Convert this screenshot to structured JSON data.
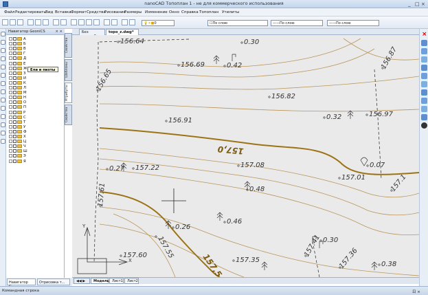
{
  "window": {
    "title": "nanoCAD Топоплан 1 - не для коммерческого использования",
    "controls": [
      "_",
      "□",
      "×"
    ]
  },
  "menu": [
    "Файл",
    "Редактировать",
    "Вид",
    "Вставка",
    "Формат",
    "Средства",
    "Рисование",
    "Размеры",
    "Изменение",
    "Окно",
    "Справка",
    "Топоплан",
    "Утилиты"
  ],
  "toolbar": {
    "layer": "0",
    "color": "По слою",
    "linetype": "По слою",
    "lineweight": "По слою"
  },
  "navigator": {
    "title": "Навигатор GeoniCS",
    "close": "× ×",
    "items": [
      "А",
      "Б",
      "В",
      "Г",
      "Д",
      "Е",
      "Ж",
      "З",
      "И",
      "К",
      "Л",
      "М",
      "Н",
      "О",
      "П",
      "Р",
      "С",
      "Т",
      "У",
      "Ф",
      "Х",
      "Ц",
      "Ч",
      "Ш",
      "Э",
      "Я"
    ],
    "tooltip": "Ели и пихты"
  },
  "side_tabs": [
    "Свойства",
    "Шаблоны",
    "Атрибуты",
    "Свойства"
  ],
  "nav_tabs": [
    "Навигатор G...",
    "Отрисовка т..."
  ],
  "doc_tabs": [
    "Без имени0",
    "topo_z.dwg*"
  ],
  "doc_tab_close": "×",
  "layout_tabs": [
    "Модель",
    "Лист1",
    "Лист2"
  ],
  "command_line": {
    "label": "Командная строка",
    "close": "ㄖ ×"
  },
  "drawing": {
    "point_labels": [
      "156.64",
      "156.65",
      "156.69",
      "0.42",
      "0.30",
      "156.87",
      "156.82",
      "0.32",
      "156.97",
      "156.91",
      "0.27",
      "157.22",
      "157.08",
      "0.07",
      "0.48",
      "157.01",
      "157.1",
      "0.26",
      "0.46",
      "157.55",
      "0.30",
      "157.60",
      "157.35",
      "157.41",
      "157.36",
      "0.38",
      "157.61"
    ],
    "contour_labels": [
      "157,0",
      "157,5"
    ],
    "ucs": {
      "y": "Y",
      "x": "X"
    }
  }
}
